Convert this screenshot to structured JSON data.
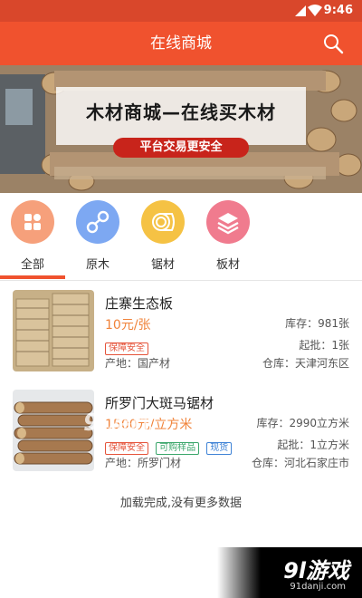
{
  "status_bar": {
    "time": "9:46"
  },
  "header": {
    "title": "在线商城"
  },
  "banner": {
    "headline": "木材商城—在线买木材",
    "tagline": "平台交易更安全"
  },
  "categories": [
    {
      "label": "全部",
      "icon": "grid-icon",
      "color": "#f6a07b"
    },
    {
      "label": "原木",
      "icon": "logs-icon",
      "color": "#7da8f2"
    },
    {
      "label": "锯材",
      "icon": "wood-slice-icon",
      "color": "#f5c244"
    },
    {
      "label": "板材",
      "icon": "stack-layers-icon",
      "color": "#f07b8e"
    }
  ],
  "products": [
    {
      "name": "庄寨生态板",
      "price": "10元/张",
      "stock": "库存：981张",
      "tags": [
        "保障安全"
      ],
      "moq": "起批：1张",
      "origin": "产地：国产材",
      "warehouse": "仓库：天津河东区"
    },
    {
      "name": "所罗门大斑马锯材",
      "price": "1500元/立方米",
      "stock": "库存：2990立方米",
      "tags": [
        "保障安全",
        "可购样品",
        "现货"
      ],
      "moq": "起批：1立方米",
      "origin": "产地：所罗门材",
      "warehouse": "仓库：河北石家庄市"
    }
  ],
  "list_footer": "加载完成,没有更多数据",
  "watermark": {
    "text": "9l游戏",
    "url": "91danji.com"
  },
  "colors": {
    "accent": "#f0522e",
    "status_bar": "#d9472b",
    "price": "#f0833a"
  }
}
